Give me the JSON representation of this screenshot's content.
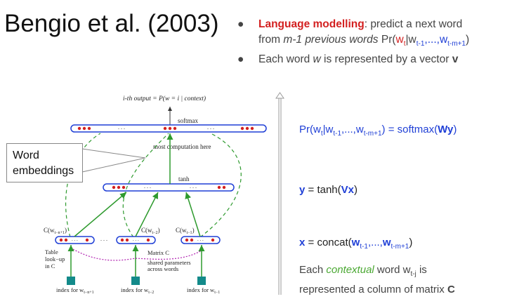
{
  "title": "Bengio et al. (2003)",
  "bullets": {
    "b1_lead": "Language modelling",
    "b1_rest": ": predict a next word",
    "b1_line2_a": "from ",
    "b1_line2_italic": "m-1 previous words",
    "b1_line2_pr": " Pr(",
    "b1_w": "w",
    "b1_wsub": "t",
    "b1_bar": "|w",
    "b1_sub1": "t-1",
    "b1_dots": ",...,w",
    "b1_sub2": "t-m+1",
    "b1_close": ")",
    "b2_a": "Each word ",
    "b2_w": "w",
    "b2_b": " is represented by a vector ",
    "b2_v": "v",
    "dot": "●"
  },
  "equations": {
    "eq1": {
      "pr": "Pr(w",
      "s0": "t",
      "bar": "|w",
      "s1": "t-1",
      "mid": ",...,w",
      "s2": "t-m+1",
      "rest": ") = softmax(",
      "bold": "Wy",
      "end": ")"
    },
    "eq2": {
      "y": "y",
      "rest": " = tanh(",
      "bold": "Vx",
      "end": ")"
    },
    "eq3": {
      "x": "x",
      "rest": " = concat(",
      "w1": "w",
      "s1": "t-1",
      "mid": ",...,",
      "w2": "w",
      "s2": "t-m+1",
      "end": ")"
    },
    "eq4": {
      "a": "Each ",
      "ctx": "contextual",
      "b": " word w",
      "sub": "t-j",
      "c": " is",
      "line2": "represented a column of matrix ",
      "C": "C"
    }
  },
  "callout": {
    "line1": "Word",
    "line2": "embeddings"
  },
  "diagram": {
    "output_label": "i-th output = P(w  = i | context)",
    "output_sub": "t",
    "softmax": "softmax",
    "most_computation": "most  computation here",
    "tanh": "tanh",
    "c_first": "C(w",
    "c_first_sub": "t−n+1",
    "c_second": "C(w",
    "c_second_sub": "t−2",
    "c_third": "C(w",
    "c_third_sub": "t−1",
    "close_paren": ")",
    "table1": "Table",
    "table2": "look−up",
    "table3": "in C",
    "matrix": "Matrix C",
    "shared1": "shared parameters",
    "shared2": "across words",
    "index1": "index for w",
    "index1_sub": "t−n+1",
    "index2": "index for w",
    "index2_sub": "t−2",
    "index3": "index for w",
    "index3_sub": "t−1",
    "dots": ". . .",
    "colors": {
      "blue": "#1f3fd6",
      "red": "#d32020",
      "green": "#2e9a2e",
      "purple": "#b020b0",
      "teal": "#138a8a"
    }
  }
}
